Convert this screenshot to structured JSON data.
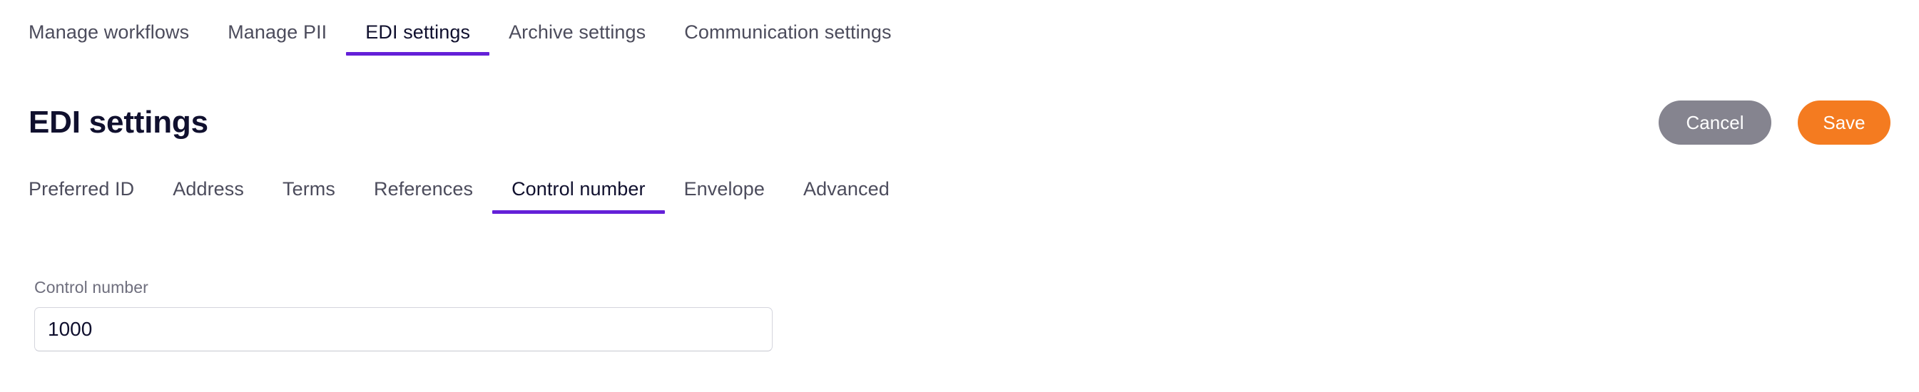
{
  "top_nav": {
    "items": [
      {
        "label": "Manage workflows",
        "active": false
      },
      {
        "label": "Manage PII",
        "active": false
      },
      {
        "label": "EDI settings",
        "active": true
      },
      {
        "label": "Archive settings",
        "active": false
      },
      {
        "label": "Communication settings",
        "active": false
      }
    ]
  },
  "header": {
    "title": "EDI settings",
    "cancel_label": "Cancel",
    "save_label": "Save"
  },
  "sub_nav": {
    "items": [
      {
        "label": "Preferred ID",
        "active": false
      },
      {
        "label": "Address",
        "active": false
      },
      {
        "label": "Terms",
        "active": false
      },
      {
        "label": "References",
        "active": false
      },
      {
        "label": "Control number",
        "active": true
      },
      {
        "label": "Envelope",
        "active": false
      },
      {
        "label": "Advanced",
        "active": false
      }
    ]
  },
  "form": {
    "control_number": {
      "label": "Control number",
      "value": "1000",
      "placeholder": "Control number"
    }
  },
  "colors": {
    "accent_purple": "#6420d8",
    "save_orange": "#f47b20",
    "cancel_gray": "#85848f",
    "text_dark": "#10102e",
    "text_muted": "#4c4c5c",
    "label_gray": "#6e6e7d",
    "border_gray": "#d4d5dd",
    "background": "#ffffff"
  }
}
